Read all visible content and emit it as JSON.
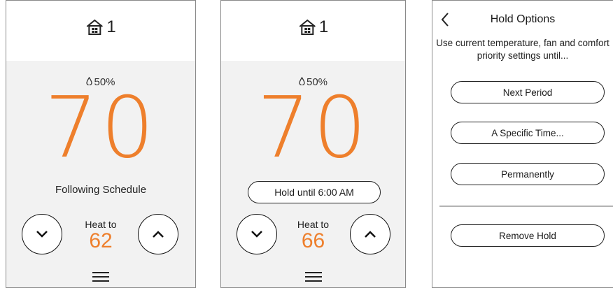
{
  "screens": [
    {
      "zone_number": "1",
      "humidity": "50%",
      "temperature": "70",
      "status": "Following Schedule",
      "setpoint_label": "Heat to",
      "setpoint_value": "62"
    },
    {
      "zone_number": "1",
      "humidity": "50%",
      "temperature": "70",
      "hold_label": "Hold until 6:00 AM",
      "setpoint_label": "Heat to",
      "setpoint_value": "66"
    }
  ],
  "hold_options": {
    "title": "Hold Options",
    "description": "Use current temperature, fan and comfort priority settings until...",
    "options": [
      "Next Period",
      "A Specific Time...",
      "Permanently"
    ],
    "remove_label": "Remove Hold"
  },
  "colors": {
    "accent": "#ee7f2c",
    "text": "#1a1a1a",
    "background": "#f2f2f2"
  },
  "icons": [
    "home-zone-icon",
    "humidity-drop-icon",
    "chevron-down-icon",
    "chevron-up-icon",
    "menu-icon",
    "back-icon"
  ]
}
